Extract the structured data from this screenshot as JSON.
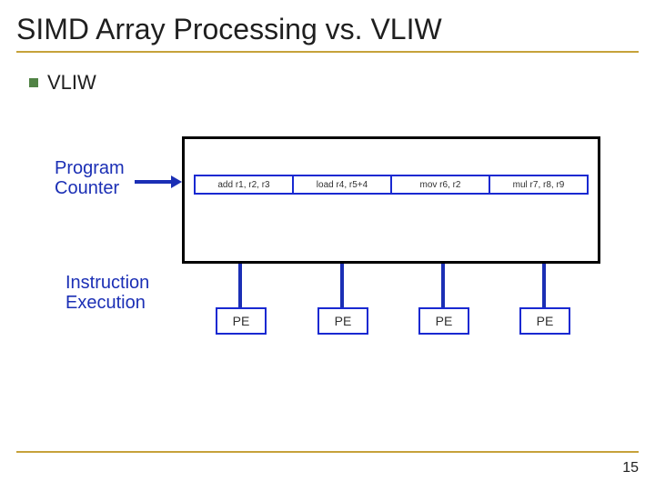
{
  "title": "SIMD Array Processing vs. VLIW",
  "bullet": "VLIW",
  "diagram": {
    "program_counter_label": "Program\nCounter",
    "execution_label": "Instruction\nExecution",
    "instructions": [
      "add r1, r2, r3",
      "load r4, r5+4",
      "mov r6, r2",
      "mul r7, r8, r9"
    ],
    "pe_label": "PE",
    "pe_count": 4
  },
  "page_number": "15",
  "colors": {
    "accent_rule": "#c6a23a",
    "bullet_square": "#518345",
    "diagram_blue": "#1b2fb5"
  }
}
